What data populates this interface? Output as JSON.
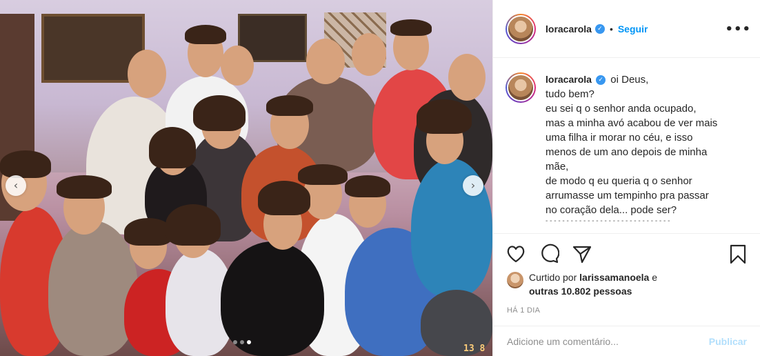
{
  "post": {
    "username": "loracarola",
    "verified_glyph": "✓",
    "follow_label": "Seguir",
    "follow_separator": "•",
    "more_label": "•••"
  },
  "caption": {
    "username": "loracarola",
    "lines": [
      "oi Deus,",
      "tudo bem?",
      "eu sei q o senhor anda ocupado,",
      "mas a minha avó acabou de ver mais",
      "uma filha ir morar no céu, e isso",
      "menos de um ano depois de minha",
      "mãe,",
      "de modo q eu queria q o senhor",
      "arrumasse um tempinho pra passar",
      "no coração dela... pode ser?",
      "- - - - - - - - - - - - - - - - - - - - - - - - - - - - - -"
    ]
  },
  "carousel": {
    "prev_glyph": "‹",
    "next_glyph": "›",
    "slide_count": 3,
    "active_index": 2,
    "date_stamp": "13 8"
  },
  "actions": {
    "like_icon": "heart-icon",
    "comment_icon": "comment-icon",
    "share_icon": "paper-plane-icon",
    "save_icon": "bookmark-icon"
  },
  "likes": {
    "prefix": "Curtido por",
    "user": "larissamanoela",
    "joiner": "e",
    "others": "outras 10.802 pessoas"
  },
  "timestamp": "HÁ 1 DIA",
  "comment_box": {
    "placeholder": "Adicione um comentário...",
    "publish_label": "Publicar"
  },
  "colors": {
    "accent": "#0095f6",
    "verified": "#3897f0",
    "publish_disabled": "#b2dffc",
    "muted": "#8e8e8e"
  }
}
